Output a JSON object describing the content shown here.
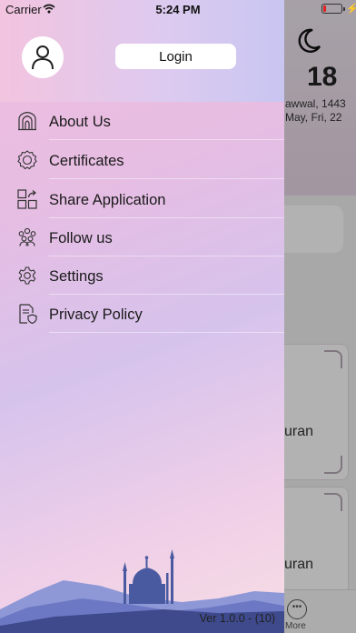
{
  "status_bar": {
    "carrier": "Carrier",
    "time": "5:24 PM"
  },
  "background": {
    "day_number": "18",
    "hijri_date": "awwal, 1443",
    "gregorian_date": "May, Fri, 22",
    "card1_label": "uran",
    "card2_label": "uran",
    "tab_more_label": "More"
  },
  "drawer": {
    "login_label": "Login",
    "menu": [
      {
        "label": "About Us",
        "icon": "mosque-arch-icon"
      },
      {
        "label": "Certificates",
        "icon": "certificate-badge-icon"
      },
      {
        "label": "Share Application",
        "icon": "share-app-icon"
      },
      {
        "label": "Follow us",
        "icon": "people-group-icon"
      },
      {
        "label": "Settings",
        "icon": "gear-icon"
      },
      {
        "label": "Privacy Policy",
        "icon": "document-shield-icon"
      }
    ],
    "version": "Ver 1.0.0 - (10)"
  },
  "colors": {
    "drawer_gradient_start": "#f0bedf",
    "drawer_gradient_mid": "#d6c3ec",
    "mosque_color": "#4a5aa0"
  }
}
